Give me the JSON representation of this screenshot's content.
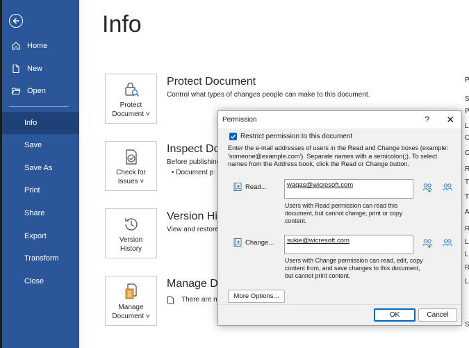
{
  "sidebar": {
    "items": [
      {
        "label": "Home"
      },
      {
        "label": "New"
      },
      {
        "label": "Open"
      },
      {
        "label": "Info"
      },
      {
        "label": "Save"
      },
      {
        "label": "Save As"
      },
      {
        "label": "Print"
      },
      {
        "label": "Share"
      },
      {
        "label": "Export"
      },
      {
        "label": "Transform"
      },
      {
        "label": "Close"
      }
    ],
    "active": "Info"
  },
  "main": {
    "title": "Info",
    "sections": [
      {
        "tile_line1": "Protect",
        "tile_line2": "Document ˅",
        "title": "Protect Document",
        "desc": "Control what types of changes people can make to this document."
      },
      {
        "tile_line1": "Check for",
        "tile_line2": "Issues ˅",
        "title": "Inspect Do",
        "desc": "Before publishing",
        "bullet": "•    Document p"
      },
      {
        "tile_line1": "Version",
        "tile_line2": "History",
        "title": "Version His",
        "desc": "View and restore"
      },
      {
        "tile_line1": "Manage",
        "tile_line2": "Document ˅",
        "title": "Manage Do",
        "desc": "There are no"
      }
    ],
    "right_column_letters": [
      "P",
      "S",
      "P",
      "L",
      "C",
      "C",
      "R",
      "T",
      "T",
      "A",
      "R",
      "L",
      "L",
      "R",
      "L",
      "S"
    ]
  },
  "dialog": {
    "title": "Permission",
    "help": "?",
    "close": "✕",
    "restrict_label": "Restrict permission to this document",
    "instructions": "Enter the e-mail addresses of users in the Read and Change boxes (example: 'someone@example.com'). Separate names with a semicolon(;). To select names from the Address book, click the Read or Change button.",
    "read": {
      "label": "Read...",
      "value": "waqas@wicresoft.com",
      "help": "Users with Read permission can read this document, but cannot change, print or copy content."
    },
    "change": {
      "label": "Change...",
      "value": "sukie@wicresoft.com",
      "help": "Users with Change permission can read, edit, copy content from, and save changes to this document, but cannot print content."
    },
    "more_options": "More Options...",
    "ok": "OK",
    "cancel": "Cancel"
  },
  "colors": {
    "sidebar": "#2b579a",
    "sidebar_active": "#1e4276",
    "accent": "#0067c0"
  }
}
